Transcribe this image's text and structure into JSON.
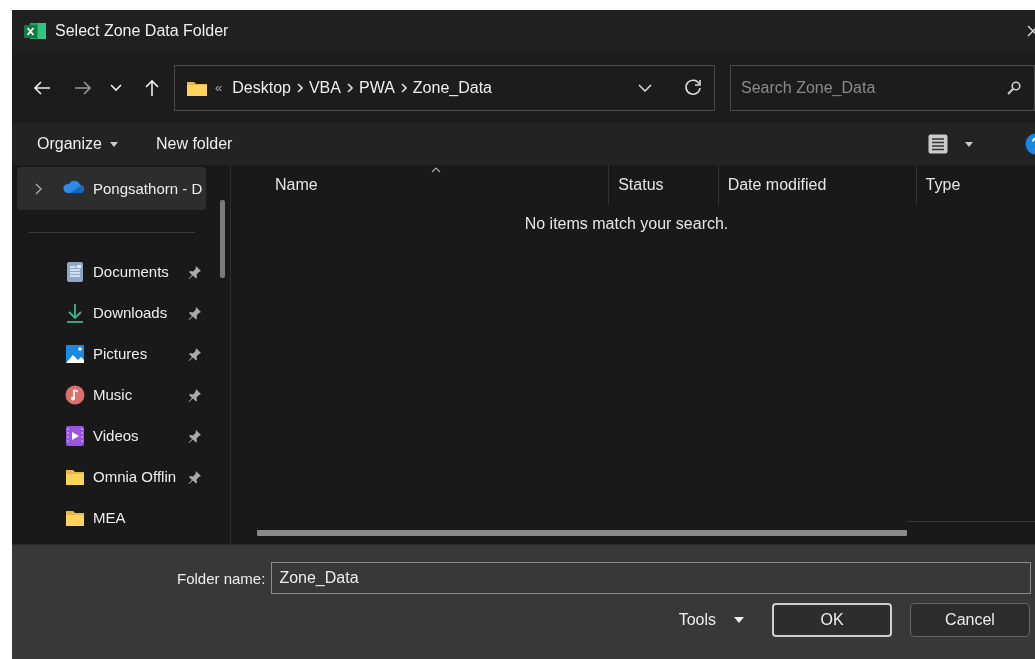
{
  "window": {
    "title": "Select Zone Data Folder"
  },
  "navigation": {
    "overflow_mark": "«",
    "breadcrumb": [
      "Desktop",
      "VBA",
      "PWA",
      "Zone_Data"
    ],
    "search": {
      "placeholder": "Search Zone_Data"
    }
  },
  "toolbar": {
    "organize": "Organize",
    "new_folder": "New folder"
  },
  "sidebar": {
    "items": [
      {
        "label": "Pongsathorn - D",
        "kind": "cloud",
        "expandable": true,
        "selected": true,
        "pinned": false
      },
      {
        "label": "Documents",
        "kind": "documents",
        "expandable": false,
        "selected": false,
        "pinned": true
      },
      {
        "label": "Downloads",
        "kind": "downloads",
        "expandable": false,
        "selected": false,
        "pinned": true
      },
      {
        "label": "Pictures",
        "kind": "pictures",
        "expandable": false,
        "selected": false,
        "pinned": true
      },
      {
        "label": "Music",
        "kind": "music",
        "expandable": false,
        "selected": false,
        "pinned": true
      },
      {
        "label": "Videos",
        "kind": "videos",
        "expandable": false,
        "selected": false,
        "pinned": true
      },
      {
        "label": "Omnia Offlin",
        "kind": "folder",
        "expandable": false,
        "selected": false,
        "pinned": true
      },
      {
        "label": "MEA",
        "kind": "folder",
        "expandable": false,
        "selected": false,
        "pinned": false
      }
    ]
  },
  "file_list": {
    "columns": [
      {
        "label": "Name",
        "sorted": true
      },
      {
        "label": "Status",
        "sorted": false
      },
      {
        "label": "Date modified",
        "sorted": false
      },
      {
        "label": "Type",
        "sorted": false
      }
    ],
    "empty_message": "No items match your search."
  },
  "footer": {
    "folder_name_label": "Folder name:",
    "folder_name": "Zone_Data",
    "tools": "Tools",
    "buttons": [
      {
        "label": "OK",
        "default": true
      },
      {
        "label": "Cancel",
        "default": false
      }
    ]
  }
}
